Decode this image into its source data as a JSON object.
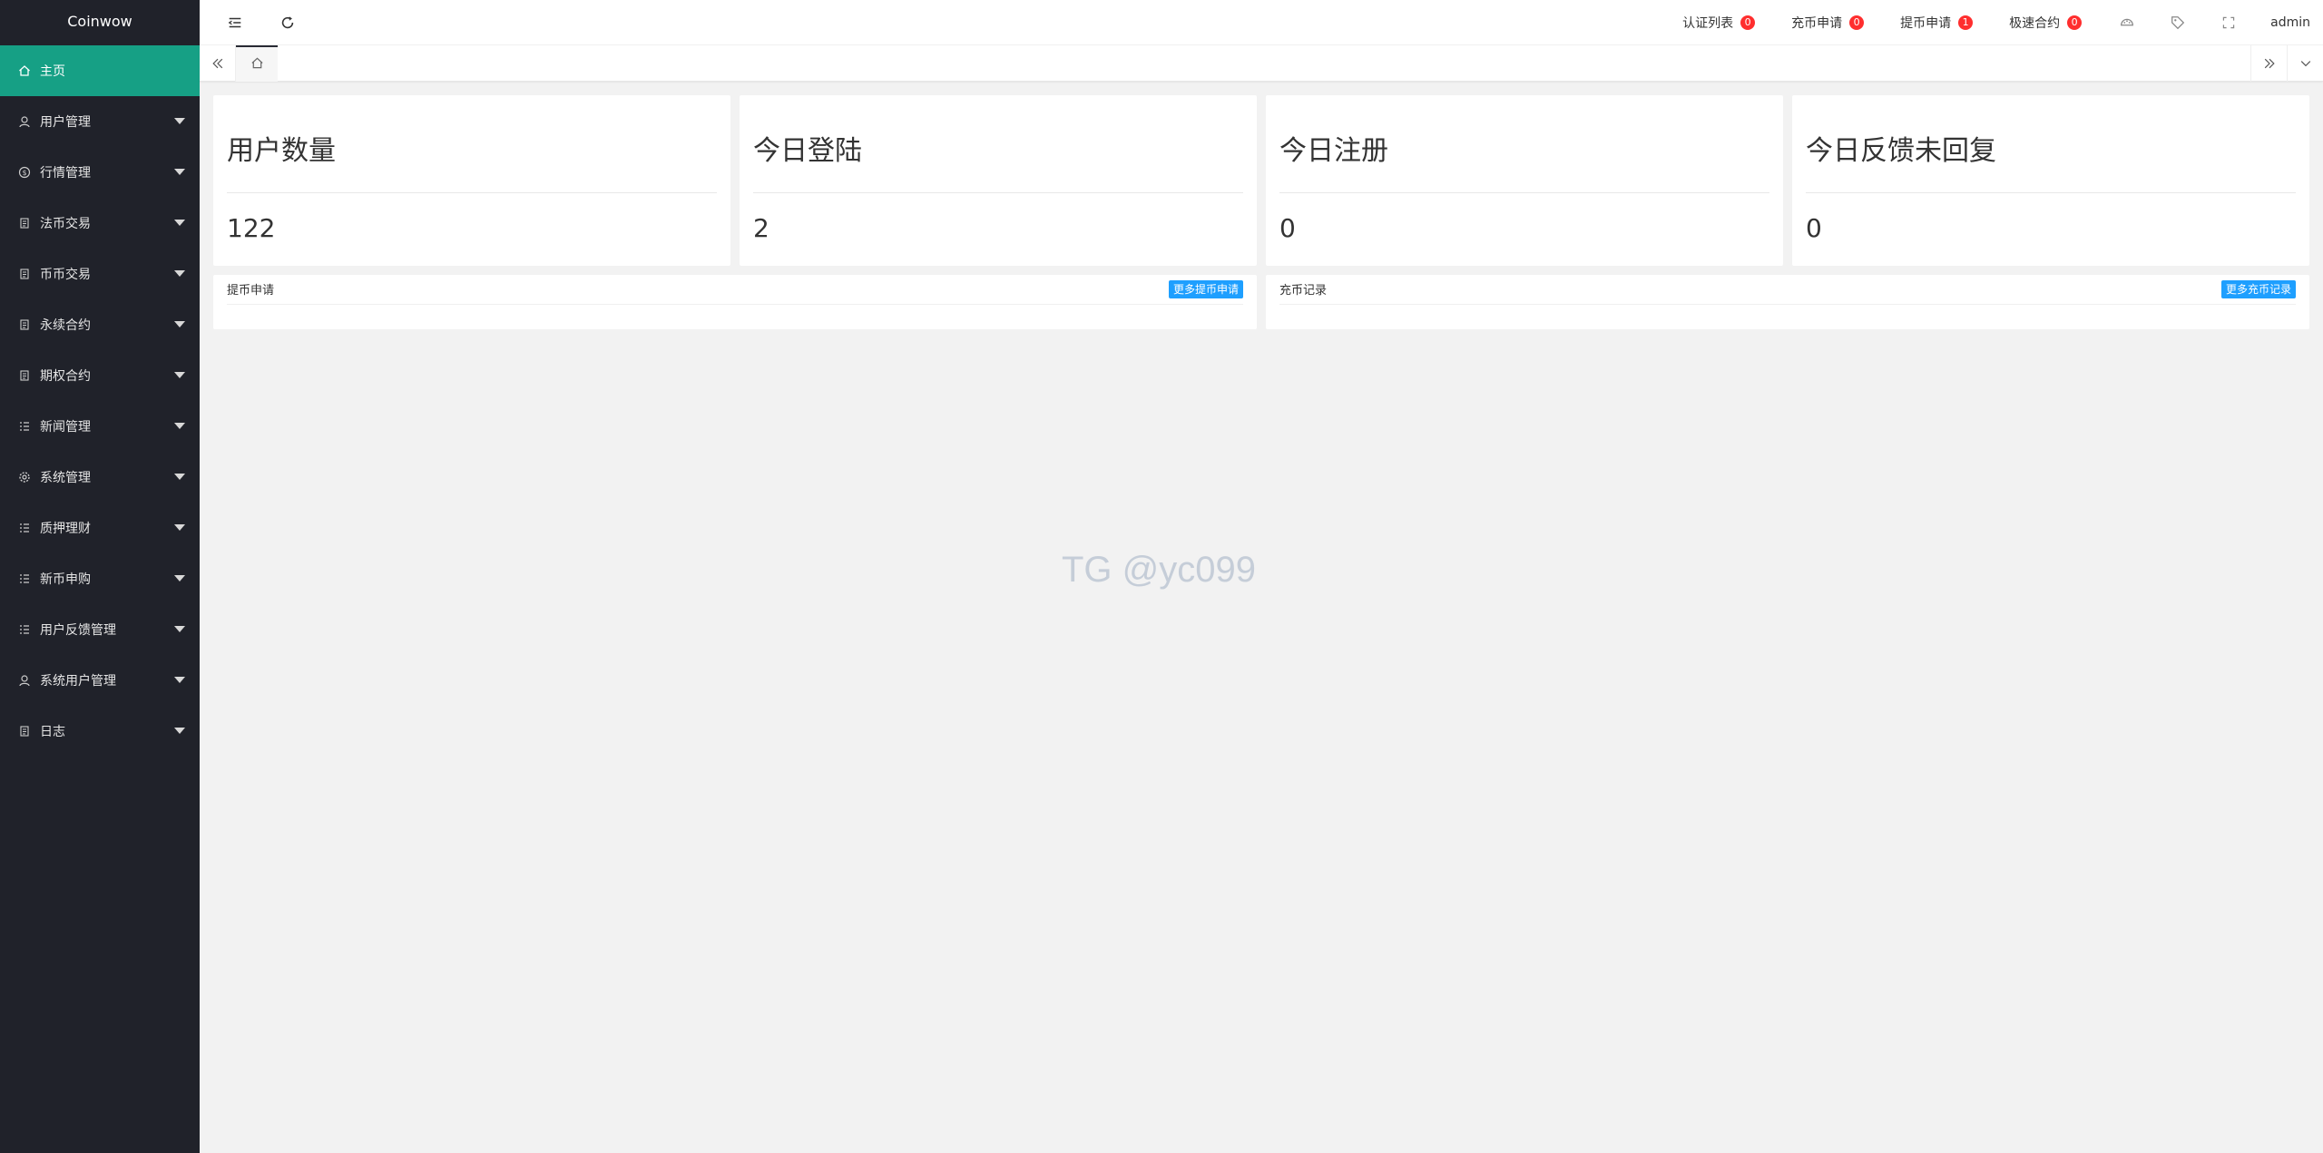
{
  "app": {
    "title": "Coinwow"
  },
  "sidebar": {
    "items": [
      {
        "label": "主页",
        "icon": "home-icon",
        "active": true
      },
      {
        "label": "用户管理",
        "icon": "user-icon"
      },
      {
        "label": "行情管理",
        "icon": "dollar-icon"
      },
      {
        "label": "法币交易",
        "icon": "doc-icon"
      },
      {
        "label": "币币交易",
        "icon": "doc-icon"
      },
      {
        "label": "永续合约",
        "icon": "doc-icon"
      },
      {
        "label": "期权合约",
        "icon": "doc-icon"
      },
      {
        "label": "新闻管理",
        "icon": "list-icon"
      },
      {
        "label": "系统管理",
        "icon": "gear-icon"
      },
      {
        "label": "质押理财",
        "icon": "list-icon"
      },
      {
        "label": "新币申购",
        "icon": "list-icon"
      },
      {
        "label": "用户反馈管理",
        "icon": "list-icon"
      },
      {
        "label": "系统用户管理",
        "icon": "user-icon"
      },
      {
        "label": "日志",
        "icon": "doc-icon"
      }
    ]
  },
  "header": {
    "links": [
      {
        "label": "认证列表",
        "count": "0"
      },
      {
        "label": "充币申请",
        "count": "0"
      },
      {
        "label": "提币申请",
        "count": "1"
      },
      {
        "label": "极速合约",
        "count": "0"
      }
    ],
    "user": "admin"
  },
  "stats": [
    {
      "title": "用户数量",
      "value": "122"
    },
    {
      "title": "今日登陆",
      "value": "2"
    },
    {
      "title": "今日注册",
      "value": "0"
    },
    {
      "title": "今日反馈未回复",
      "value": "0"
    }
  ],
  "panels": [
    {
      "title": "提币申请",
      "button": "更多提币申请"
    },
    {
      "title": "充币记录",
      "button": "更多充币记录"
    }
  ],
  "watermark": "TG @yc099",
  "colors": {
    "sidebar_bg": "#20222a",
    "active_item": "#16a085",
    "badge": "#ff2e2e",
    "button_blue": "#1e9fff"
  }
}
